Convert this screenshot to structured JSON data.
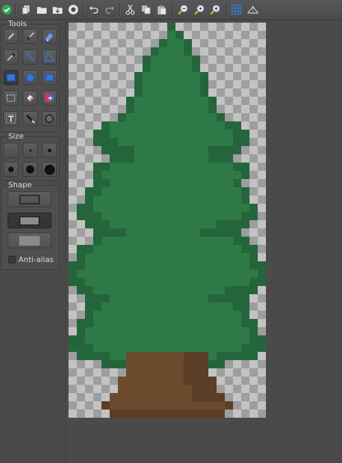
{
  "toolbar": {
    "buttons": [
      {
        "name": "apply-icon"
      },
      {
        "name": "new-layer-icon"
      },
      {
        "name": "open-folder-icon"
      },
      {
        "name": "import-folder-icon"
      },
      {
        "name": "record-icon"
      },
      {
        "name": "undo-icon"
      },
      {
        "name": "redo-icon"
      },
      {
        "name": "cut-icon"
      },
      {
        "name": "copy-icon"
      },
      {
        "name": "paste-icon"
      },
      {
        "name": "zoom-out-icon"
      },
      {
        "name": "zoom-reset-icon"
      },
      {
        "name": "zoom-in-icon"
      },
      {
        "name": "grid-icon"
      },
      {
        "name": "symmetry-icon"
      }
    ]
  },
  "panel": {
    "tools_label": "Tools",
    "size_label": "Size",
    "shape_label": "Shape",
    "antialias_label": "Anti-alias",
    "antialias_checked": false,
    "active_tool": "rectangle",
    "active_shape": "filled-outline"
  },
  "colors": {
    "canvas_bg": "#4a4a4a",
    "tree_light": "#2e7a47",
    "tree_dark": "#25653b",
    "trunk": "#6b4a2e",
    "trunk_dark": "#5b3e26",
    "checker_light": "#9e9e9e",
    "checker_dark": "#c3c3c3",
    "accent": "#3b73d8"
  }
}
